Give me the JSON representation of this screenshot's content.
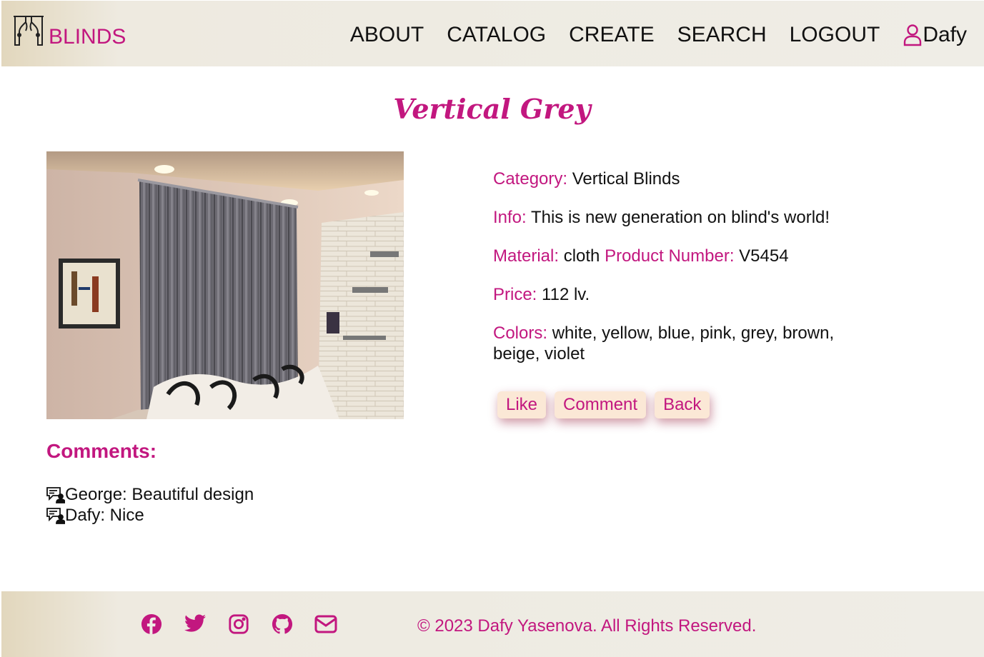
{
  "header": {
    "logo_text": "BLINDS",
    "nav": [
      {
        "label": "ABOUT"
      },
      {
        "label": "CATALOG"
      },
      {
        "label": "CREATE"
      },
      {
        "label": "SEARCH"
      },
      {
        "label": "LOGOUT"
      }
    ],
    "username": "Dafy"
  },
  "product": {
    "title": "Vertical Grey",
    "category_label": "Category:",
    "category": "Vertical Blinds",
    "info_label": "Info:",
    "info": "This is new generation on blind's world!",
    "material_label": "Material:",
    "material": "cloth",
    "product_number_label": "Product Number:",
    "product_number": "V5454",
    "price_label": "Price:",
    "price": "112 lv.",
    "colors_label": "Colors:",
    "colors": "white, yellow, blue, pink, grey, brown, beige, violet"
  },
  "actions": {
    "like": "Like",
    "comment": "Comment",
    "back": "Back"
  },
  "comments": {
    "heading": "Comments:",
    "items": [
      {
        "text": "George: Beautiful design"
      },
      {
        "text": "Dafy: Nice"
      }
    ]
  },
  "footer": {
    "icons": [
      "facebook-icon",
      "twitter-icon",
      "instagram-icon",
      "github-icon",
      "mail-icon"
    ],
    "copyright": "© 2023 Dafy Yasenova. All Rights Reserved."
  },
  "colors": {
    "accent": "#c2177f",
    "button_bg": "#fbe8d6",
    "bar_bg": "#efede6"
  }
}
